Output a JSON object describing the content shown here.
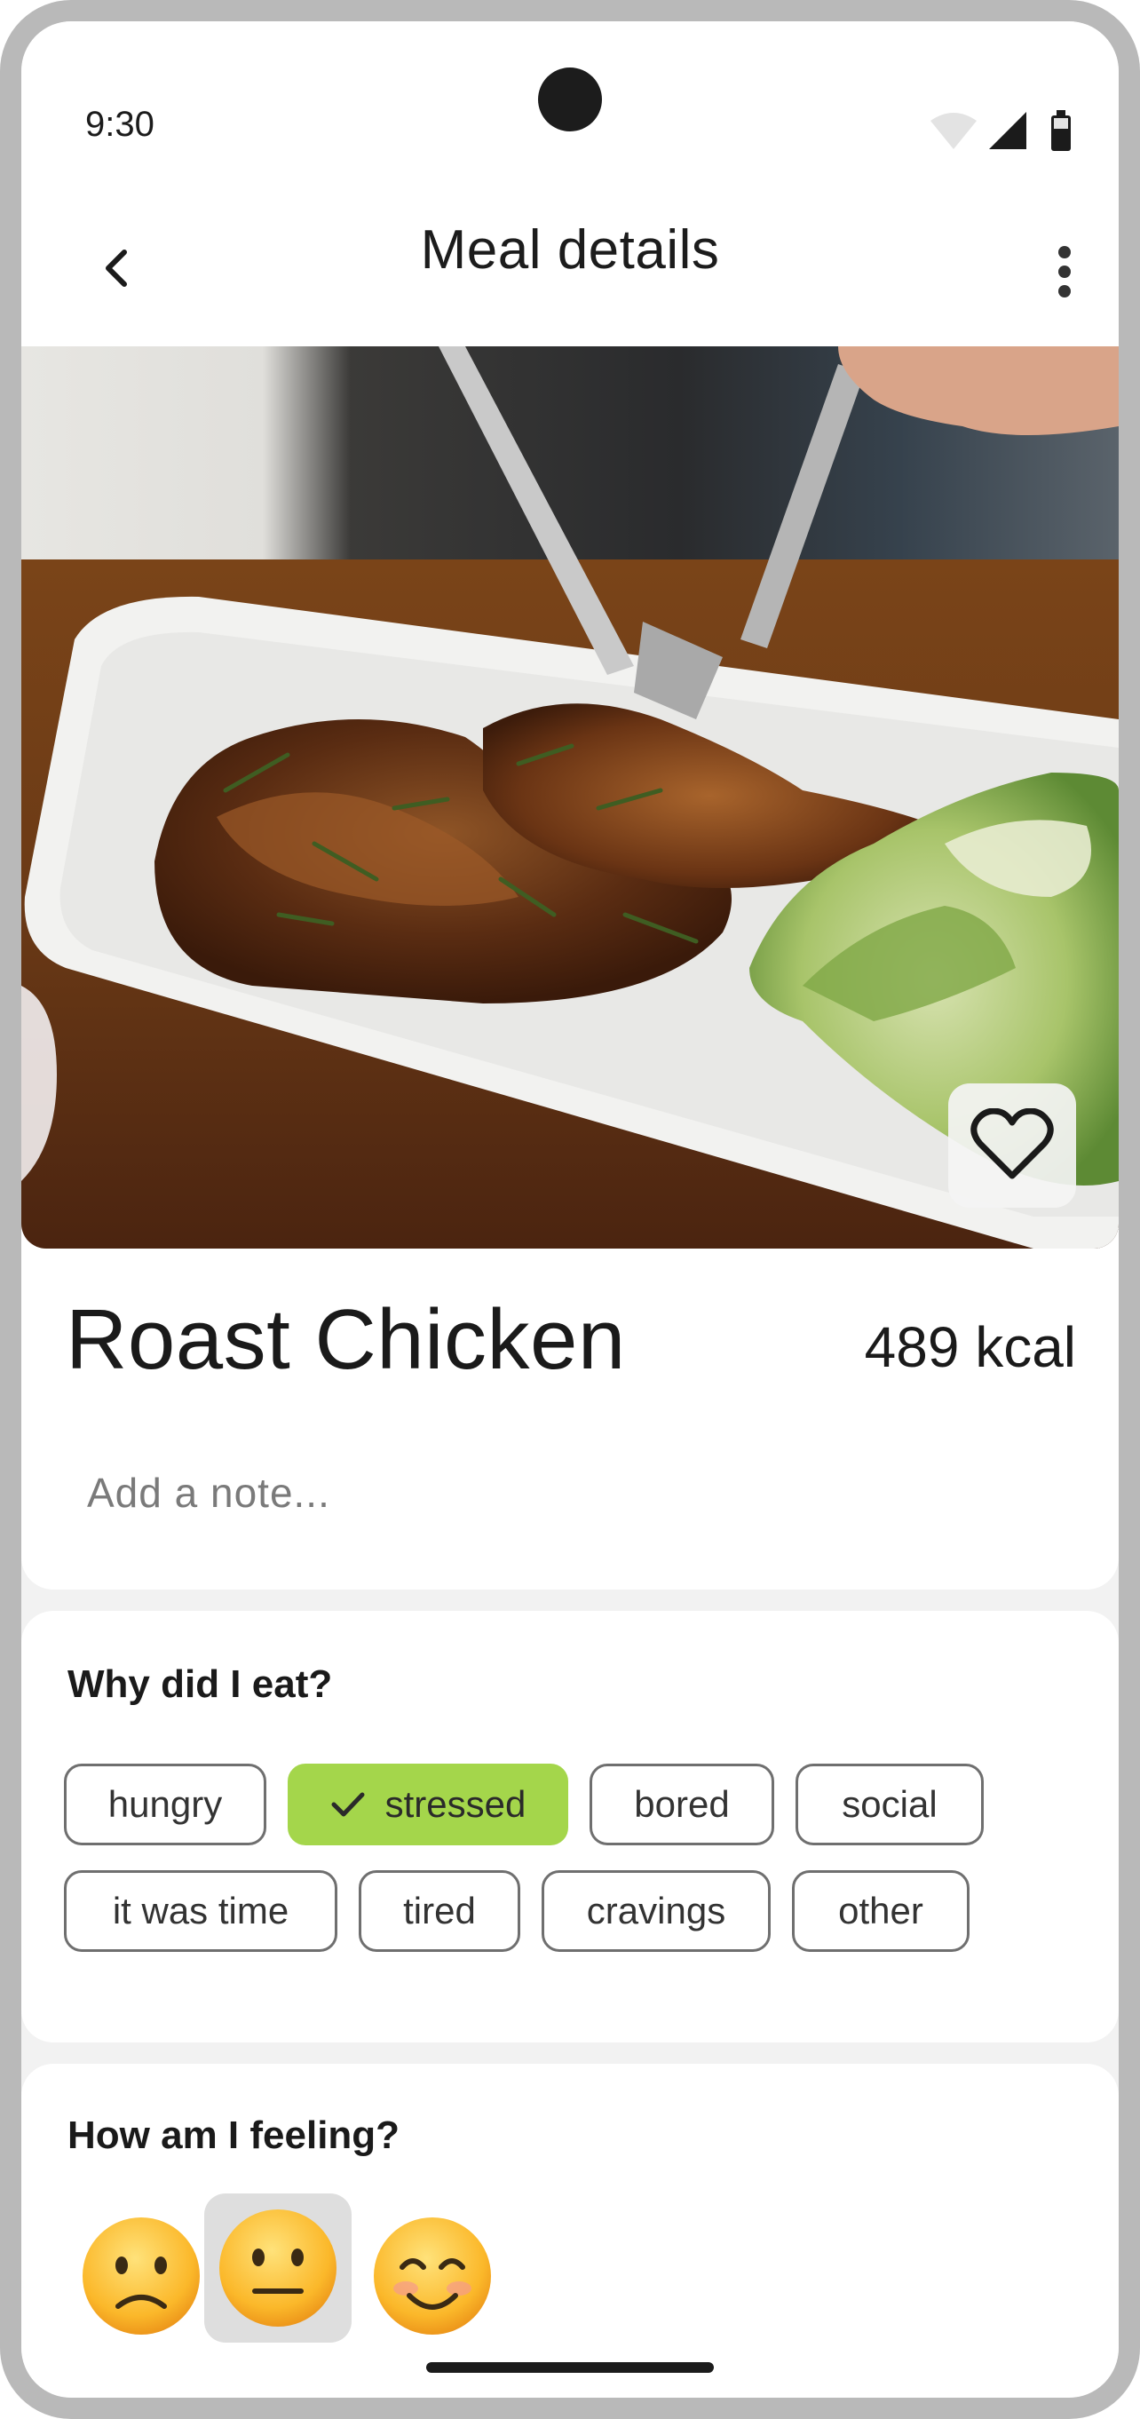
{
  "status_bar": {
    "time": "9:30",
    "icons": [
      "wifi-icon",
      "signal-icon",
      "battery-icon"
    ]
  },
  "app_bar": {
    "title": "Meal details",
    "back_icon": "chevron-left-icon",
    "menu_icon": "more-vertical-icon"
  },
  "meal": {
    "name": "Roast Chicken",
    "calories": "489 kcal",
    "photo_description_icon": "meal-photo",
    "favorite_icon": "heart-outline-icon",
    "note_placeholder": "Add a note...",
    "note_value": ""
  },
  "why": {
    "title": "Why did I eat?",
    "chips": [
      {
        "label": "hungry",
        "selected": false
      },
      {
        "label": "stressed",
        "selected": true
      },
      {
        "label": "bored",
        "selected": false
      },
      {
        "label": "social",
        "selected": false
      },
      {
        "label": "it was time",
        "selected": false
      },
      {
        "label": "tired",
        "selected": false
      },
      {
        "label": "cravings",
        "selected": false
      },
      {
        "label": "other",
        "selected": false
      }
    ]
  },
  "feeling": {
    "title": "How am I feeling?",
    "options": [
      {
        "icon": "slightly-frowning-face-icon",
        "selected": false
      },
      {
        "icon": "neutral-face-icon",
        "selected": true
      },
      {
        "icon": "smiling-face-icon",
        "selected": false
      }
    ]
  },
  "colors": {
    "accent": "#a4d64b",
    "chip_border": "#6f6f6f",
    "background": "#f2f2f2"
  }
}
